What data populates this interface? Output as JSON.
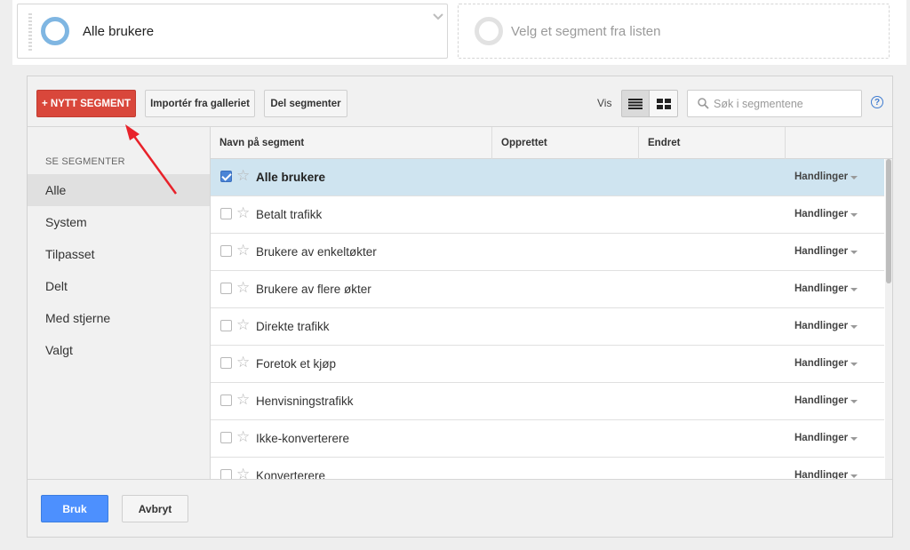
{
  "segment_bar": {
    "active_segment": "Alle brukere",
    "empty_slot_placeholder": "Velg et segment fra listen"
  },
  "toolbar": {
    "new_segment_label": "+ NYTT SEGMENT",
    "import_label": "Importér fra galleriet",
    "share_label": "Del segmenter",
    "view_label": "Vis",
    "search_placeholder": "Søk i segmentene",
    "help_label": "?"
  },
  "sidebar": {
    "heading": "SE SEGMENTER",
    "items": [
      {
        "label": "Alle",
        "active": true
      },
      {
        "label": "System",
        "active": false
      },
      {
        "label": "Tilpasset",
        "active": false
      },
      {
        "label": "Delt",
        "active": false
      },
      {
        "label": "Med stjerne",
        "active": false
      },
      {
        "label": "Valgt",
        "active": false
      }
    ]
  },
  "table": {
    "columns": [
      "Navn på segment",
      "Opprettet",
      "Endret"
    ],
    "rows": [
      {
        "name": "Alle brukere",
        "checked": true,
        "action": "Handlinger"
      },
      {
        "name": "Betalt trafikk",
        "checked": false,
        "action": "Handlinger"
      },
      {
        "name": "Brukere av enkeltøkter",
        "checked": false,
        "action": "Handlinger"
      },
      {
        "name": "Brukere av flere økter",
        "checked": false,
        "action": "Handlinger"
      },
      {
        "name": "Direkte trafikk",
        "checked": false,
        "action": "Handlinger"
      },
      {
        "name": "Foretok et kjøp",
        "checked": false,
        "action": "Handlinger"
      },
      {
        "name": "Henvisningstrafikk",
        "checked": false,
        "action": "Handlinger"
      },
      {
        "name": "Ikke-konverterere",
        "checked": false,
        "action": "Handlinger"
      },
      {
        "name": "Konverterere",
        "checked": false,
        "action": "Handlinger"
      }
    ]
  },
  "footer": {
    "apply_label": "Bruk",
    "cancel_label": "Avbryt"
  },
  "colors": {
    "new_segment_button": "#d9473b",
    "apply_button": "#4d90fe",
    "selected_row": "#cfe4f0",
    "annotation_arrow": "#e8222a"
  }
}
